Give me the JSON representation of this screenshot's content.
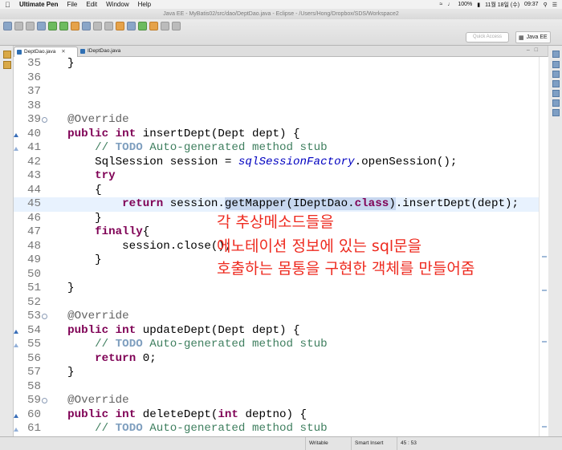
{
  "menubar": {
    "app": "Ultimate Pen",
    "items": [
      "File",
      "Edit",
      "Window",
      "Help"
    ],
    "battery": "100%",
    "date": "11월 18일 (수)",
    "time": "09:37"
  },
  "window_title": "Java EE - MyBatis02/src/dao/DeptDao.java - Eclipse - /Users/Hong/Dropbox/SDS/Workspace2",
  "toolbar": {
    "quick_access_placeholder": "Quick Access",
    "perspective": "Java EE"
  },
  "tabs": [
    {
      "label": "DeptDao.java",
      "active": true
    },
    {
      "label": "IDeptDao.java",
      "active": false
    }
  ],
  "editor": {
    "lines": [
      {
        "n": "35",
        "code": "    }"
      },
      {
        "n": "36",
        "code": ""
      },
      {
        "n": "37",
        "code": ""
      },
      {
        "n": "38",
        "code": ""
      },
      {
        "n": "39",
        "code": "    @Override",
        "fold": true
      },
      {
        "n": "40",
        "code": "    public int insertDept(Dept dept) {",
        "override": true
      },
      {
        "n": "41",
        "code": "        // TODO Auto-generated method stub",
        "marker": true
      },
      {
        "n": "42",
        "code": "        SqlSession session = sqlSessionFactory.openSession();"
      },
      {
        "n": "43",
        "code": "        try"
      },
      {
        "n": "44",
        "code": "        {"
      },
      {
        "n": "45",
        "code": "            return session.getMapper(IDeptDao.class).insertDept(dept);",
        "current": true
      },
      {
        "n": "46",
        "code": "        }"
      },
      {
        "n": "47",
        "code": "        finally{"
      },
      {
        "n": "48",
        "code": "            session.close();"
      },
      {
        "n": "49",
        "code": "        }"
      },
      {
        "n": "50",
        "code": ""
      },
      {
        "n": "51",
        "code": "    }"
      },
      {
        "n": "52",
        "code": ""
      },
      {
        "n": "53",
        "code": "    @Override",
        "fold": true
      },
      {
        "n": "54",
        "code": "    public int updateDept(Dept dept) {",
        "override": true
      },
      {
        "n": "55",
        "code": "        // TODO Auto-generated method stub",
        "marker": true
      },
      {
        "n": "56",
        "code": "        return 0;"
      },
      {
        "n": "57",
        "code": "    }"
      },
      {
        "n": "58",
        "code": ""
      },
      {
        "n": "59",
        "code": "    @Override",
        "fold": true
      },
      {
        "n": "60",
        "code": "    public int deleteDept(int deptno) {",
        "override": true
      },
      {
        "n": "61",
        "code": "        // TODO Auto-generated method stub",
        "marker": true
      }
    ]
  },
  "annotation": {
    "lines": [
      "각 추상메소드들을",
      "에노테이션 정보에 있는 sql문을",
      "호출하는 몸통을 구현한 객체를 만들어줌"
    ],
    "color": "#ee2a1f"
  },
  "statusbar": {
    "writable": "Writable",
    "insert_mode": "Smart Insert",
    "position": "45 : 53"
  }
}
